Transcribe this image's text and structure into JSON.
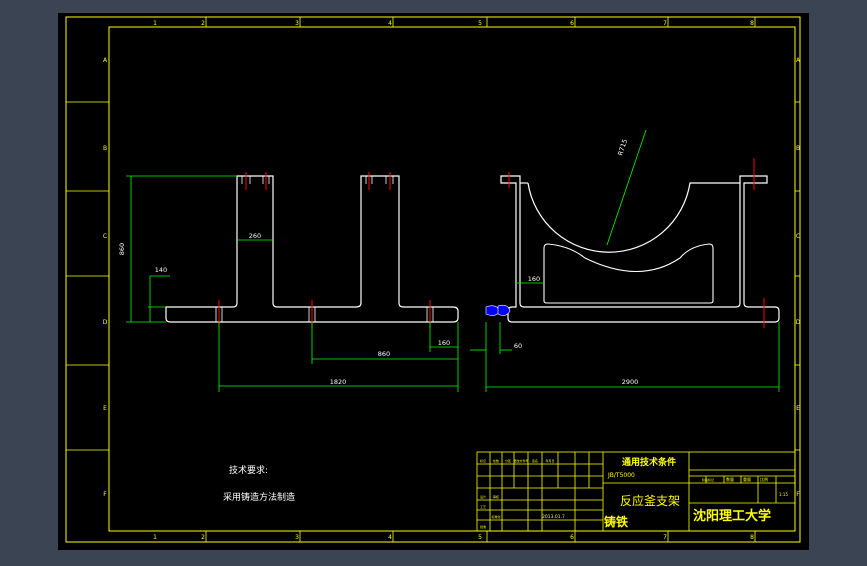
{
  "colors": {
    "viewport_bg": "#3b4452",
    "canvas": "#000000",
    "frame": "#ffff00",
    "outline": "#ffffff",
    "dimension": "#00ff00",
    "centerline": "#ff0000",
    "seal": "#0000ff",
    "title_text": "#ffff00"
  },
  "grid_ref": {
    "cols": [
      "1",
      "2",
      "3",
      "4",
      "5",
      "6",
      "7",
      "8"
    ],
    "rows": [
      "A",
      "B",
      "C",
      "D",
      "E",
      "F"
    ]
  },
  "dimensions": {
    "overall_height": "860",
    "rib_width": "260",
    "base_height": "140",
    "bore_radius": "R715",
    "inner_step": "160",
    "rib_spacing": "860",
    "edge_offset": "160",
    "left_length": "1820",
    "gap": "60",
    "right_length": "2900"
  },
  "notes": {
    "heading": "技术要求:",
    "body": "采用铸造方法制造"
  },
  "title_block": {
    "standard_title": "通用技术条件",
    "standard_code": "JB/T5000",
    "part_name": "反应釜支架",
    "material": "铸铁",
    "institution": "沈阳理工大学",
    "scale_label": "比例",
    "quantity_label": "数量",
    "weight_label": "重量",
    "scale_value": "1:15",
    "date": "2013.01.7",
    "grid_labels": [
      "标记",
      "处数",
      "分区",
      "更改文件号",
      "签名",
      "年月日",
      "设计",
      "审核",
      "工艺",
      "标准化",
      "批准",
      "阶段标记"
    ]
  }
}
